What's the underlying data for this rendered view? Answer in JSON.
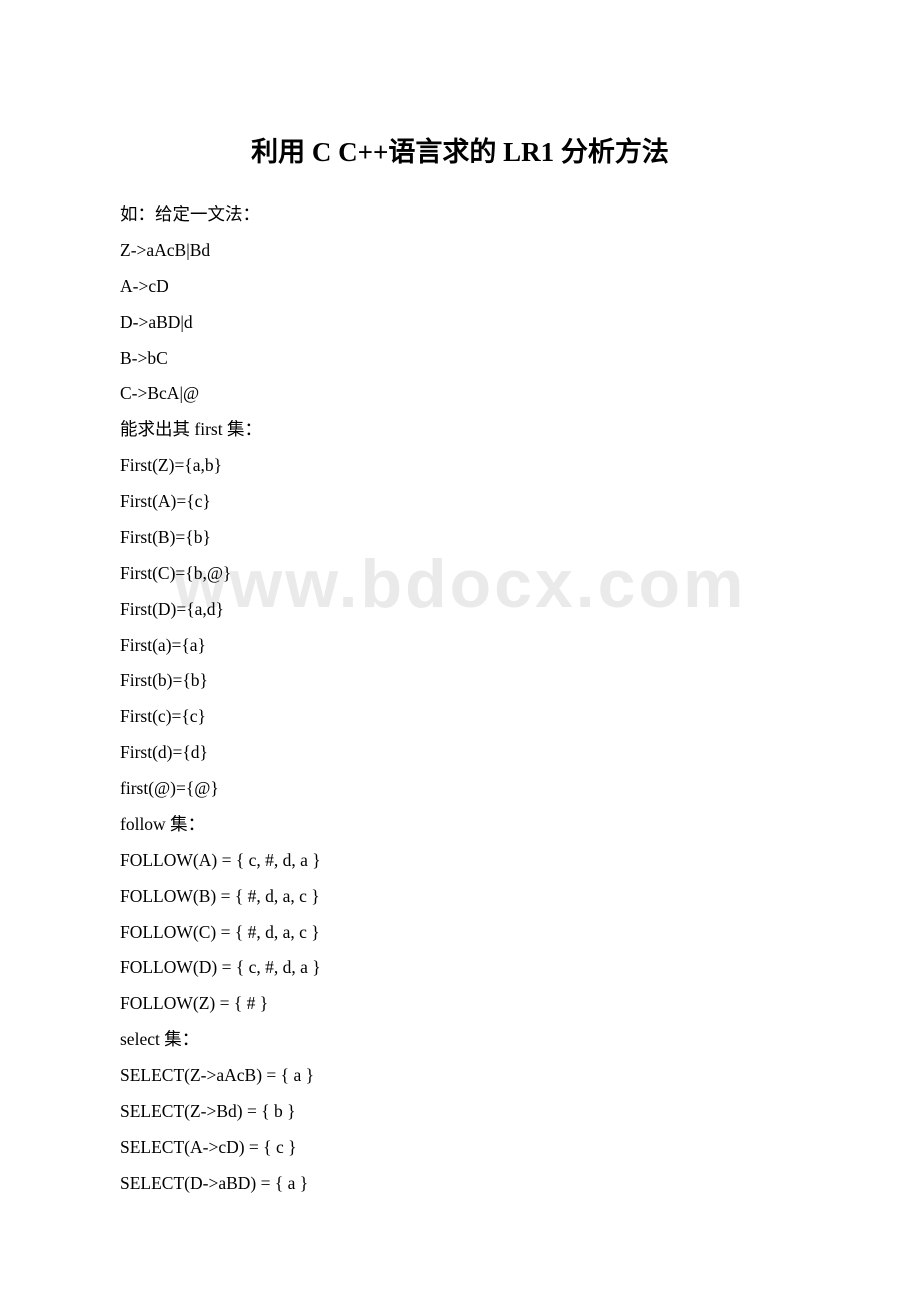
{
  "title": "利用 C C++语言求的 LR1 分析方法",
  "watermark": "www.bdocx.com",
  "lines": [
    "如：给定一文法：",
    "Z->aAcB|Bd",
    "A->cD",
    "D->aBD|d",
    "B->bC",
    "C->BcA|@",
    "能求出其 first 集：",
    "First(Z)={a,b}",
    "First(A)={c}",
    "First(B)={b}",
    "First(C)={b,@}",
    "First(D)={a,d}",
    "First(a)={a}",
    "First(b)={b}",
    "First(c)={c}",
    "First(d)={d}",
    "first(@)={@}",
    "follow 集：",
    "FOLLOW(A) = { c, #, d, a }",
    "FOLLOW(B) = { #, d, a, c }",
    "FOLLOW(C) = { #, d, a, c }",
    "FOLLOW(D) = { c, #, d, a }",
    "FOLLOW(Z) = { # }",
    "select 集：",
    "SELECT(Z->aAcB) = { a }",
    "SELECT(Z->Bd) = { b }",
    "SELECT(A->cD) = { c }",
    "SELECT(D->aBD) = { a }"
  ]
}
